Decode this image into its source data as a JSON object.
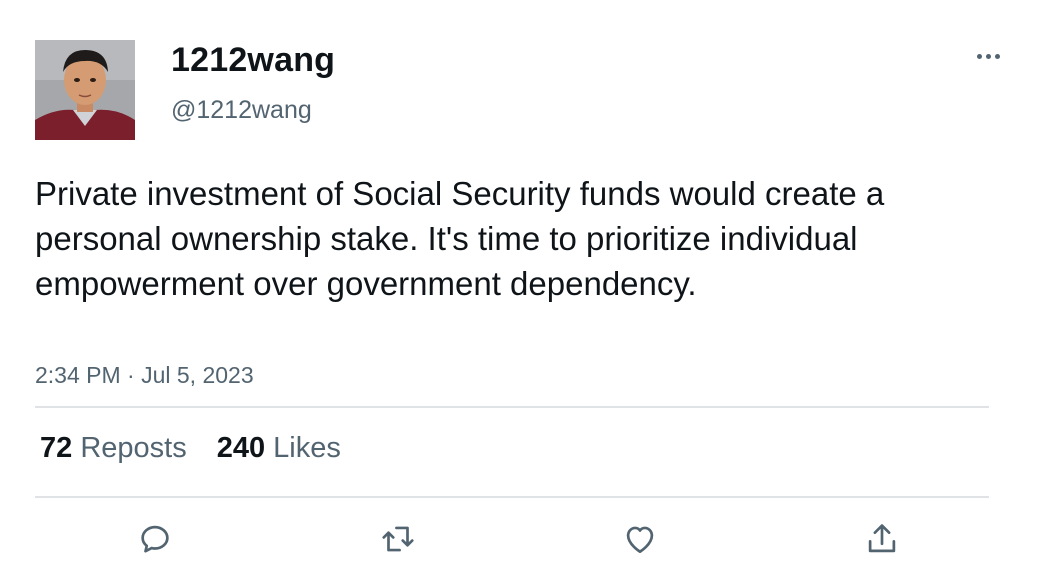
{
  "user": {
    "display_name": "1212wang",
    "handle": "@1212wang",
    "avatar_icon": "user-avatar-photo"
  },
  "tweet": {
    "text": "Private investment of Social Security funds would create a personal ownership stake. It's time to prioritize individual empowerment over government dependency.",
    "timestamp": "2:34 PM · Jul 5, 2023"
  },
  "stats": {
    "reposts_count": "72",
    "reposts_label": "Reposts",
    "likes_count": "240",
    "likes_label": "Likes"
  },
  "actions": {
    "reply_icon": "reply-icon",
    "repost_icon": "repost-icon",
    "like_icon": "heart-icon",
    "share_icon": "share-icon",
    "more_icon": "more-dots-icon"
  },
  "colors": {
    "text_primary": "#0f1419",
    "text_secondary": "#536471",
    "divider": "#dfe3e6"
  }
}
